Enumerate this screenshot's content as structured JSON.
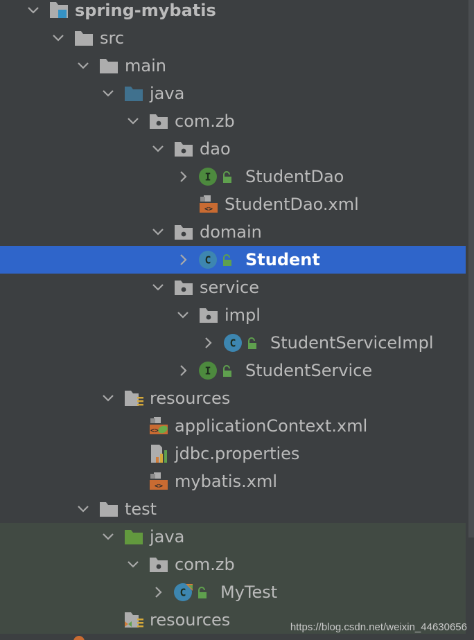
{
  "project": {
    "name": "spring-mybatis"
  },
  "tree": [
    {
      "label": "spring-mybatis",
      "level": 0,
      "expanded": true,
      "icon": "module-folder-icon",
      "bold": true
    },
    {
      "label": "src",
      "level": 1,
      "expanded": true,
      "icon": "folder-icon"
    },
    {
      "label": "main",
      "level": 2,
      "expanded": true,
      "icon": "folder-icon"
    },
    {
      "label": "java",
      "level": 3,
      "expanded": true,
      "icon": "source-root-folder-icon"
    },
    {
      "label": "com.zb",
      "level": 4,
      "expanded": true,
      "icon": "package-icon"
    },
    {
      "label": "dao",
      "level": 5,
      "expanded": true,
      "icon": "package-icon"
    },
    {
      "label": "StudentDao",
      "level": 6,
      "expanded": false,
      "icon": "interface-icon",
      "lock": true
    },
    {
      "label": "StudentDao.xml",
      "level": 6,
      "icon": "xml-file-icon"
    },
    {
      "label": "domain",
      "level": 5,
      "expanded": true,
      "icon": "package-icon"
    },
    {
      "label": "Student",
      "level": 6,
      "expanded": false,
      "icon": "class-icon",
      "lock": true,
      "selected": true
    },
    {
      "label": "service",
      "level": 5,
      "expanded": true,
      "icon": "package-icon"
    },
    {
      "label": "impl",
      "level": 6,
      "expanded": true,
      "icon": "package-icon"
    },
    {
      "label": "StudentServiceImpl",
      "level": 7,
      "expanded": false,
      "icon": "class-icon",
      "lock": true
    },
    {
      "label": "StudentService",
      "level": 6,
      "expanded": false,
      "icon": "interface-icon",
      "lock": true
    },
    {
      "label": "resources",
      "level": 3,
      "expanded": true,
      "icon": "resources-folder-icon"
    },
    {
      "label": "applicationContext.xml",
      "level": 4,
      "icon": "spring-xml-file-icon"
    },
    {
      "label": "jdbc.properties",
      "level": 4,
      "icon": "properties-file-icon"
    },
    {
      "label": "mybatis.xml",
      "level": 4,
      "icon": "xml-file-icon"
    },
    {
      "label": "test",
      "level": 2,
      "expanded": true,
      "icon": "folder-icon"
    },
    {
      "label": "java",
      "level": 3,
      "expanded": true,
      "icon": "test-root-folder-icon",
      "test": true
    },
    {
      "label": "com.zb",
      "level": 4,
      "expanded": true,
      "icon": "package-icon",
      "test": true
    },
    {
      "label": "MyTest",
      "level": 5,
      "expanded": false,
      "icon": "test-class-icon",
      "lock": true,
      "test": true
    },
    {
      "label": "resources",
      "level": 3,
      "icon": "test-resources-folder-icon",
      "test": true
    }
  ],
  "watermark": "https://blog.csdn.net/weixin_44630656",
  "colors": {
    "background": "#3c3f41",
    "selection": "#2f65ca",
    "test_background": "#414a43",
    "text": "#bbbbbb",
    "folder": "#adadad",
    "package_blue": "#40718e",
    "test_green": "#62993e",
    "interface_green": "#4d8a3e",
    "class_blue": "#3d86b0",
    "xml_orange": "#c96b32"
  }
}
